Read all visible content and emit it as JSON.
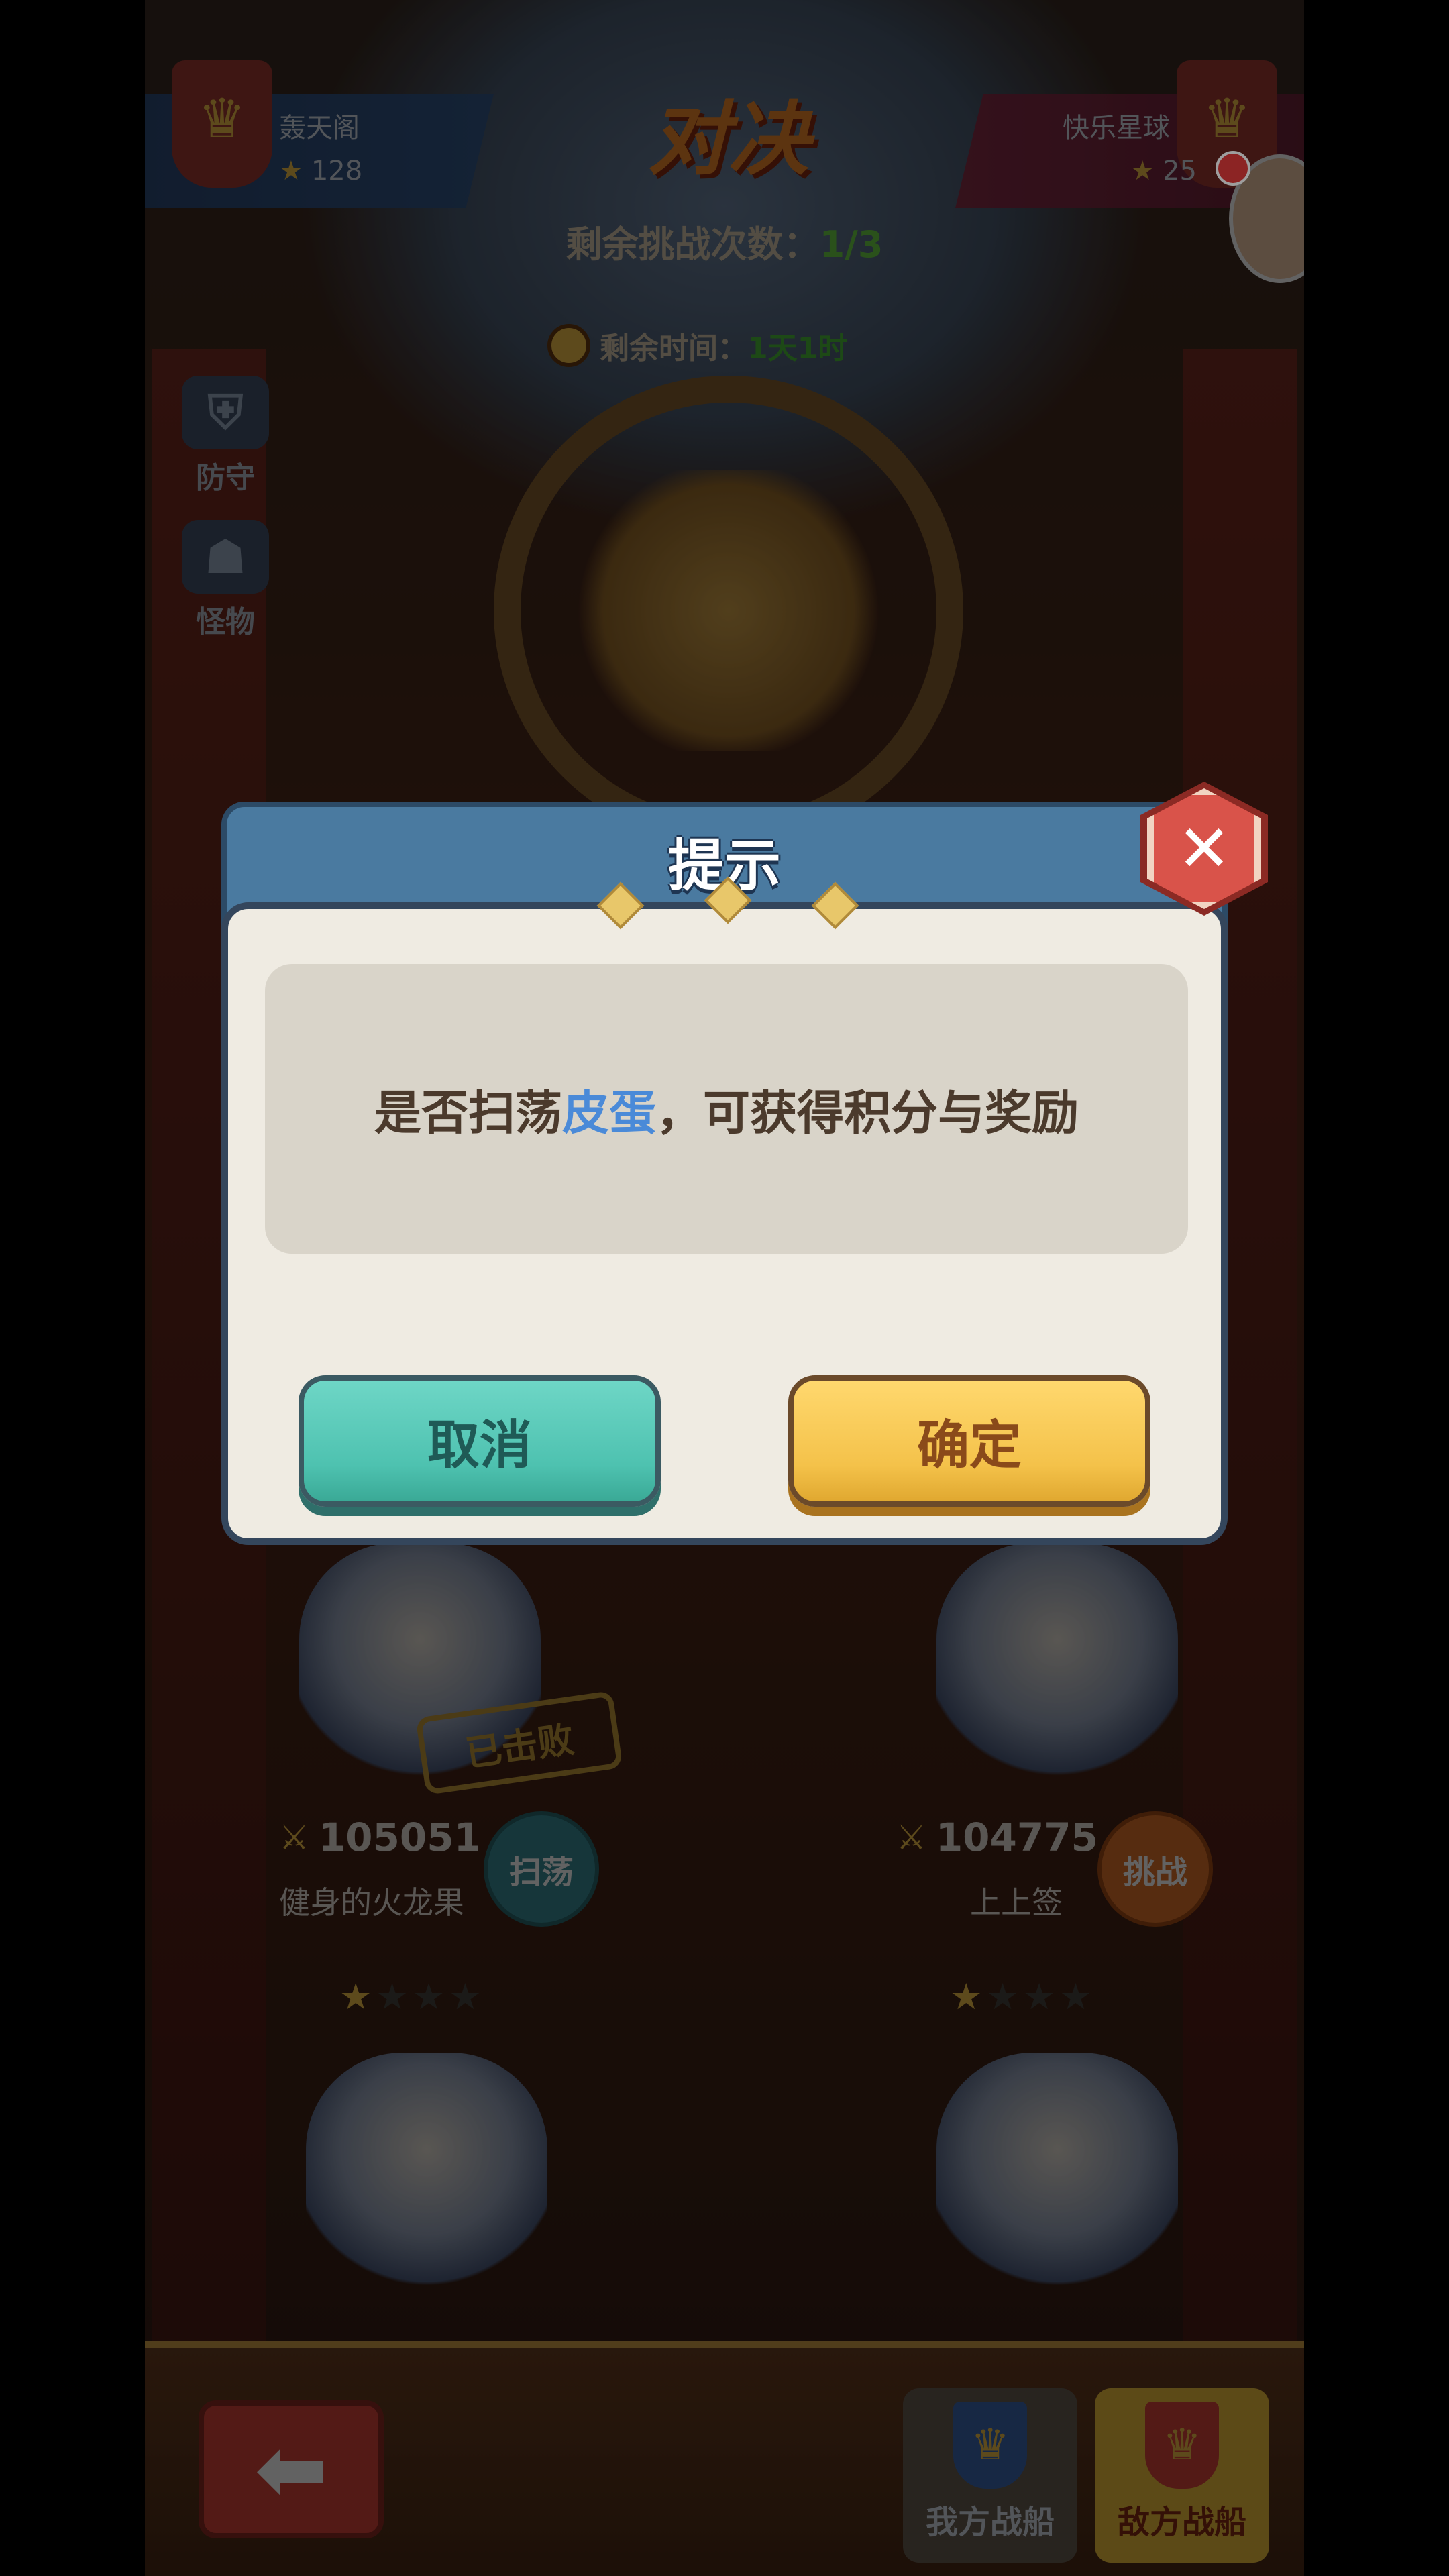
{
  "header": {
    "title": "对决",
    "left_team": {
      "name": "轰天阁",
      "score": "128"
    },
    "right_team": {
      "name": "快乐星球",
      "score": "25"
    },
    "remaining_challenges_label": "剩余挑战次数：",
    "remaining_challenges_value": "1/3",
    "remaining_time_label": "剩余时间：",
    "remaining_time_value": "1天1时"
  },
  "side_buttons": [
    {
      "label": "防守",
      "icon": "shield-icon"
    },
    {
      "label": "怪物",
      "icon": "monster-icon"
    }
  ],
  "opponents": [
    {
      "name": "健身的火龙果",
      "power": "105051",
      "action": "扫荡",
      "status": "已击败"
    },
    {
      "name": "上上签",
      "power": "104775",
      "action": "挑战"
    }
  ],
  "bottom_bar": {
    "back_icon": "arrow-left-icon",
    "my_ship_label": "我方战船",
    "enemy_ship_label": "敌方战船"
  },
  "dialog": {
    "title": "提示",
    "message_before": "是否扫荡",
    "message_highlight": "皮蛋",
    "message_after": "，可获得积分与奖励",
    "cancel_label": "取消",
    "confirm_label": "确定",
    "close_icon": "close-icon"
  },
  "colors": {
    "dialog_header": "#4a7aa0",
    "cancel_button": "#4ec2b0",
    "confirm_button": "#f4c24a",
    "highlight_text": "#4a8ad8",
    "close_button": "#d9534a"
  }
}
